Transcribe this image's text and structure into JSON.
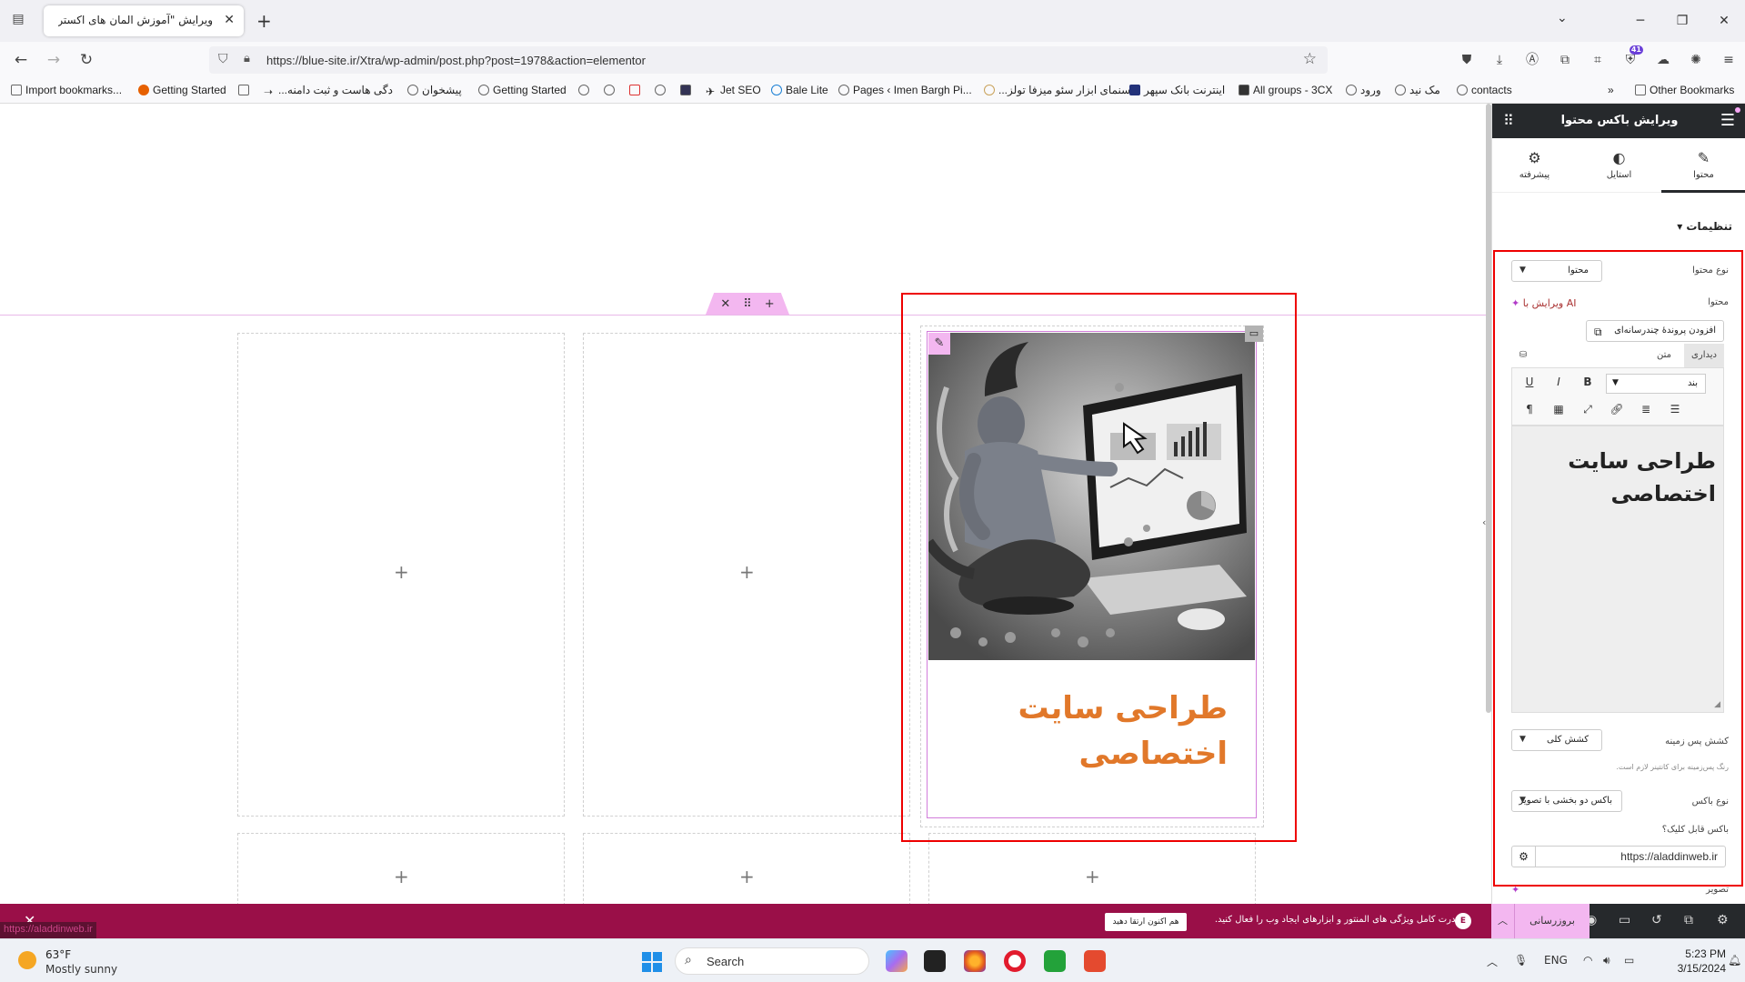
{
  "browser": {
    "tab_title": "ویرایش \"آموزش المان های اکسترا - ...",
    "url": "https://blue-site.ir/Xtra/wp-admin/post.php?post=1978&action=elementor",
    "toolbar_badge": "41",
    "bookmarks": [
      {
        "label": "Import bookmarks..."
      },
      {
        "label": "Getting Started"
      },
      {
        "label": "...دگی هاست و ثبت دامنه"
      },
      {
        "label": "پیشخوان"
      },
      {
        "label": "Getting Started"
      },
      {
        "label": "Jet SEO"
      },
      {
        "label": "Bale Lite"
      },
      {
        "label": "Pages ‹ Imen Bargh Pi..."
      },
      {
        "label": "...سنمای ابزار سئو میزفا تولز"
      },
      {
        "label": "اینترنت بانک سپهر"
      },
      {
        "label": "All groups - 3CX"
      },
      {
        "label": "ورود"
      },
      {
        "label": "مک نید"
      },
      {
        "label": "contacts"
      },
      {
        "label": "Other Bookmarks"
      }
    ]
  },
  "canvas": {
    "widget_title": "طراحی سایت اختصاصی"
  },
  "panel": {
    "header_title": "ویرایش باکس محتوا",
    "tabs": [
      {
        "label": "محتوا",
        "icon": "pencil-icon"
      },
      {
        "label": "استایل",
        "icon": "contrast-icon"
      },
      {
        "label": "پیشرفته",
        "icon": "gear-icon"
      }
    ],
    "section_title": "تنظیمات",
    "content_type_label": "نوع محتوا",
    "content_type_value": "محتوا",
    "content_label": "محتوا",
    "ai_edit_label": "ویرایش با AI",
    "add_media_label": "افزودن پروندهٔ چندرسانه‌ای",
    "editor_tab_visual": "دیداری",
    "editor_tab_text": "متن",
    "paragraph_value": "بند",
    "editor_content": "طراحی سایت اختصاصی",
    "bg_gradient_label": "کشش پس زمینه",
    "bg_gradient_value": "کشش کلی",
    "help_text": "رنگ پس‌زمینه برای کانتینر لازم است.",
    "box_type_label": "نوع باکس",
    "box_type_value": "باکس دو بخشی با تصویر",
    "link_label": "باکس قابل کلیک؟",
    "link_value": "https://aladdinweb.ir",
    "image_label": "تصویر",
    "update_button": "بروزرسانی"
  },
  "promo": {
    "message": "قدرت کامل ویژگی های المنتور و ابزارهای ایجاد وب را فعال کنید.",
    "upgrade_button": "هم اکنون ارتقا دهید",
    "e_badge": "E"
  },
  "status_url": "https://aladdinweb.ir",
  "taskbar": {
    "temperature": "63°F",
    "weather": "Mostly sunny",
    "search_placeholder": "Search",
    "language": "ENG",
    "time": "5:23 PM",
    "date": "3/15/2024"
  }
}
